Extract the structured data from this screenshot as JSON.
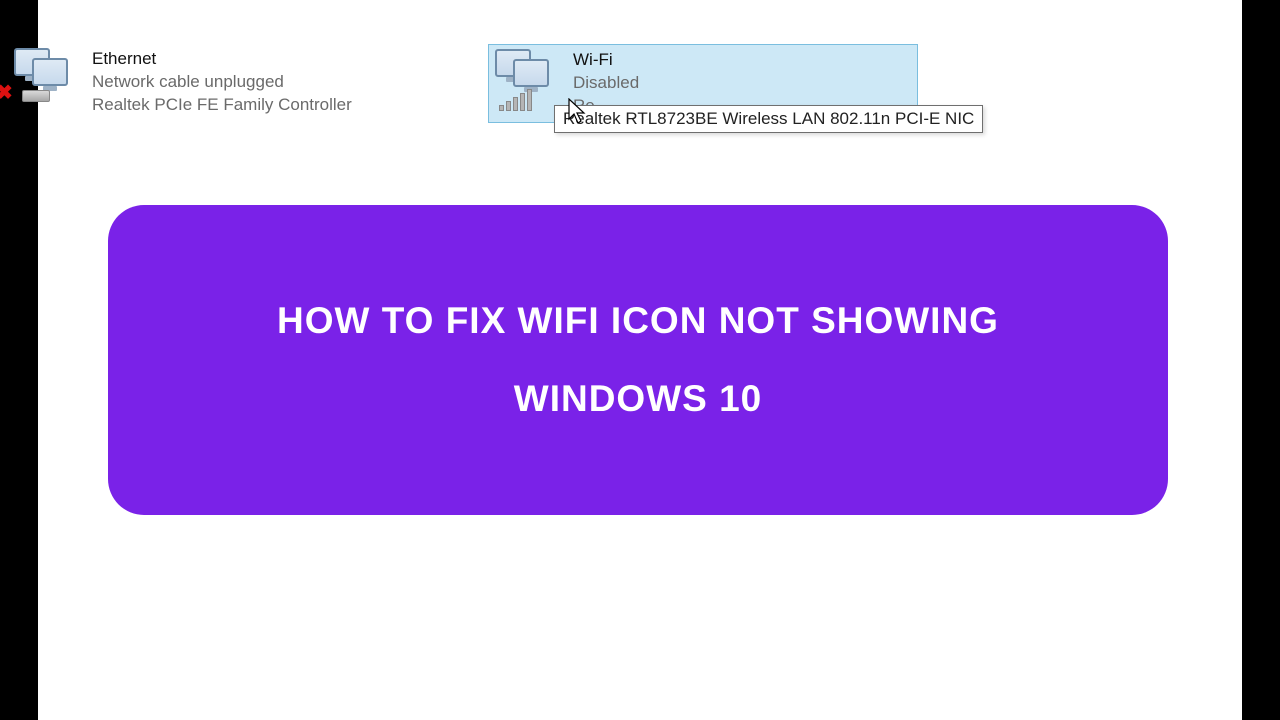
{
  "adapters": {
    "ethernet": {
      "name": "Ethernet",
      "status": "Network cable unplugged",
      "device": "Realtek PCIe FE Family Controller"
    },
    "wifi": {
      "name": "Wi-Fi",
      "status": "Disabled",
      "device_truncated": "Re",
      "tooltip": "Realtek RTL8723BE Wireless LAN 802.11n PCI-E NIC"
    }
  },
  "banner": {
    "line1": "HOW TO FIX WIFI ICON NOT SHOWING",
    "line2": "WINDOWS 10"
  }
}
